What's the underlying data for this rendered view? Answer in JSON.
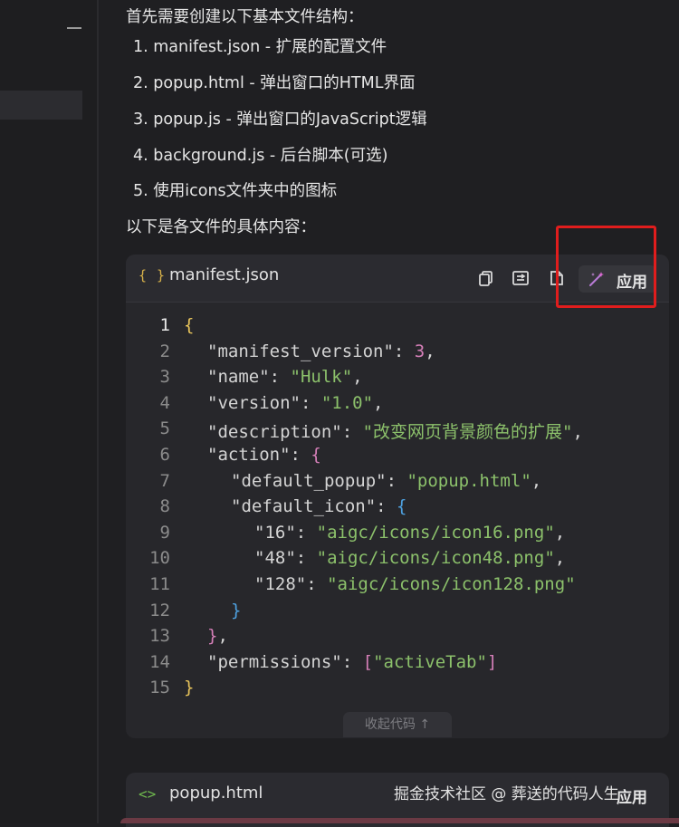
{
  "intro": "首先需要创建以下基本文件结构：",
  "steps": [
    "1. manifest.json - 扩展的配置文件",
    "2. popup.html - 弹出窗口的HTML界面",
    "3. popup.js - 弹出窗口的JavaScript逻辑",
    "4. background.js - 后台脚本(可选)",
    "5. 使用icons文件夹中的图标"
  ],
  "outro": "以下是各文件的具体内容：",
  "code_block": {
    "lang_icon": "{ }",
    "filename": "manifest.json",
    "apply_label": "应用",
    "collapse_label": "收起代码 ↑",
    "line_numbers": [
      "1",
      "2",
      "3",
      "4",
      "5",
      "6",
      "7",
      "8",
      "9",
      "10",
      "11",
      "12",
      "13",
      "14",
      "15"
    ],
    "lines": [
      {
        "t": "b1",
        "v": "{"
      },
      {
        "k": "\"manifest_version\"",
        "p": ": ",
        "v": "3",
        "vt": "n",
        "e": ","
      },
      {
        "k": "\"name\"",
        "p": ": ",
        "v": "\"Hulk\"",
        "vt": "s",
        "e": ","
      },
      {
        "k": "\"version\"",
        "p": ": ",
        "v": "\"1.0\"",
        "vt": "s",
        "e": ","
      },
      {
        "k": "\"description\"",
        "p": ": ",
        "v": "\"改变网页背景颜色的扩展\"",
        "vt": "s",
        "e": ","
      },
      {
        "k": "\"action\"",
        "p": ": ",
        "v": "{",
        "vt": "b2",
        "e": ""
      },
      {
        "k": "\"default_popup\"",
        "p": ": ",
        "v": "\"popup.html\"",
        "vt": "s",
        "e": ","
      },
      {
        "k": "\"default_icon\"",
        "p": ": ",
        "v": "{",
        "vt": "b3",
        "e": ""
      },
      {
        "k": "\"16\"",
        "p": ": ",
        "v": "\"aigc/icons/icon16.png\"",
        "vt": "s",
        "e": ","
      },
      {
        "k": "\"48\"",
        "p": ": ",
        "v": "\"aigc/icons/icon48.png\"",
        "vt": "s",
        "e": ","
      },
      {
        "k": "\"128\"",
        "p": ": ",
        "v": "\"aigc/icons/icon128.png\"",
        "vt": "s",
        "e": ""
      },
      {
        "t": "b3",
        "v": "}"
      },
      {
        "t": "b2",
        "v": "}",
        "e": ","
      },
      {
        "k": "\"permissions\"",
        "p": ": ",
        "v": "\"activeTab\"",
        "vt": "s",
        "arr": true
      },
      {
        "t": "b1",
        "v": "}"
      }
    ]
  },
  "code_block_2": {
    "lang_icon": "<>",
    "filename": "popup.html",
    "apply_label": "应用"
  },
  "watermark": "掘金技术社区 @ 葬送的代码人生",
  "icons": [
    "braces-icon",
    "copy-icon",
    "insert-icon",
    "diff-icon",
    "magic-wand-icon",
    "angle-brackets-icon"
  ],
  "colors": {
    "highlight": "#e01d1d",
    "string": "#8cc16b",
    "number": "#d57fb8"
  }
}
